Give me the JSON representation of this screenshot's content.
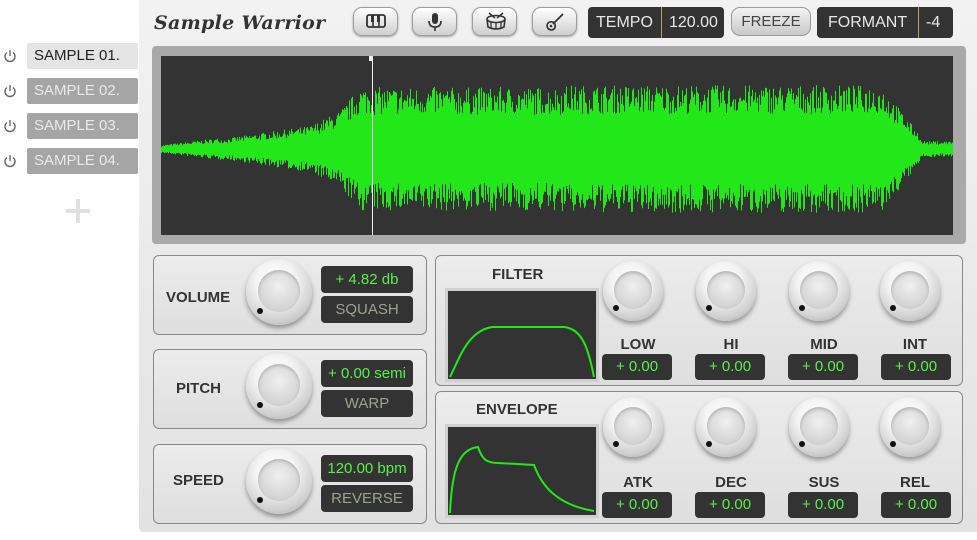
{
  "samples": [
    {
      "label": "SAMPLE 01.",
      "active": true
    },
    {
      "label": "SAMPLE 02.",
      "active": false
    },
    {
      "label": "SAMPLE 03.",
      "active": false
    },
    {
      "label": "SAMPLE 04.",
      "active": false
    }
  ],
  "header": {
    "title": "Sample Warrior",
    "instrument_icons": [
      "piano-icon",
      "microphone-icon",
      "drum-icon",
      "guitar-icon"
    ],
    "tempo_label": "TEMPO",
    "tempo_value": "120.00",
    "freeze_label": "FREEZE",
    "formant_label": "FORMANT",
    "formant_value": "-4"
  },
  "volume": {
    "label": "VOLUME",
    "value": "+ 4.82 db",
    "mode": "SQUASH"
  },
  "pitch": {
    "label": "PITCH",
    "value": "+ 0.00 semi",
    "mode": "WARP"
  },
  "speed": {
    "label": "SPEED",
    "value": "120.00 bpm",
    "mode": "REVERSE"
  },
  "filter": {
    "label": "FILTER",
    "params": [
      {
        "label": "LOW",
        "value": "+ 0.00"
      },
      {
        "label": "HI",
        "value": "+ 0.00"
      },
      {
        "label": "MID",
        "value": "+ 0.00"
      },
      {
        "label": "INT",
        "value": "+ 0.00"
      }
    ]
  },
  "envelope": {
    "label": "ENVELOPE",
    "params": [
      {
        "label": "ATK",
        "value": "+ 0.00"
      },
      {
        "label": "DEC",
        "value": "+ 0.00"
      },
      {
        "label": "SUS",
        "value": "+ 0.00"
      },
      {
        "label": "REL",
        "value": "+ 0.00"
      }
    ]
  },
  "colors": {
    "waveform": "#22e81a",
    "lcd_text": "#59f04a",
    "lcd_bg": "#333333"
  }
}
